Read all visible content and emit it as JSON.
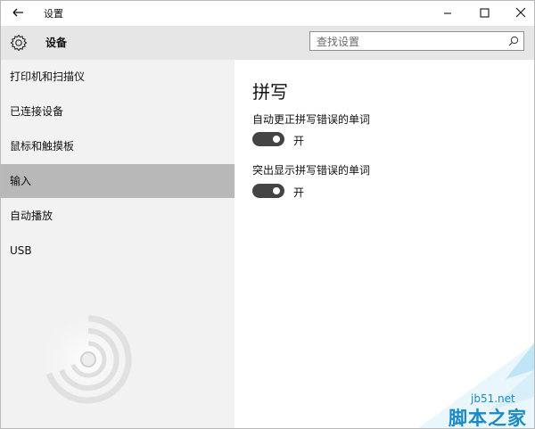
{
  "window": {
    "title": "设置",
    "back_icon": "back-arrow-icon",
    "minimize_icon": "minimize-icon",
    "maximize_icon": "maximize-icon",
    "close_icon": "close-icon"
  },
  "header": {
    "icon": "gear-icon",
    "title": "设备",
    "search": {
      "placeholder": "查找设置",
      "value": "",
      "icon": "search-icon"
    }
  },
  "sidebar": {
    "items": [
      {
        "label": "打印机和扫描仪",
        "selected": false
      },
      {
        "label": "已连接设备",
        "selected": false
      },
      {
        "label": "鼠标和触摸板",
        "selected": false
      },
      {
        "label": "输入",
        "selected": true
      },
      {
        "label": "自动播放",
        "selected": false
      },
      {
        "label": "USB",
        "selected": false
      }
    ]
  },
  "main": {
    "title": "拼写",
    "settings": [
      {
        "label": "自动更正拼写错误的单词",
        "state": "开",
        "on": true
      },
      {
        "label": "突出显示拼写错误的单词",
        "state": "开",
        "on": true
      }
    ]
  },
  "watermark": {
    "line1": "jb51.net",
    "line2": "脚本之家"
  },
  "colors": {
    "header_bg": "#e6e6e6",
    "sidebar_bg": "#f2f2f2",
    "selected_bg": "#b8b8b8",
    "toggle_on": "#444444",
    "watermark": "#1a8ac6"
  }
}
